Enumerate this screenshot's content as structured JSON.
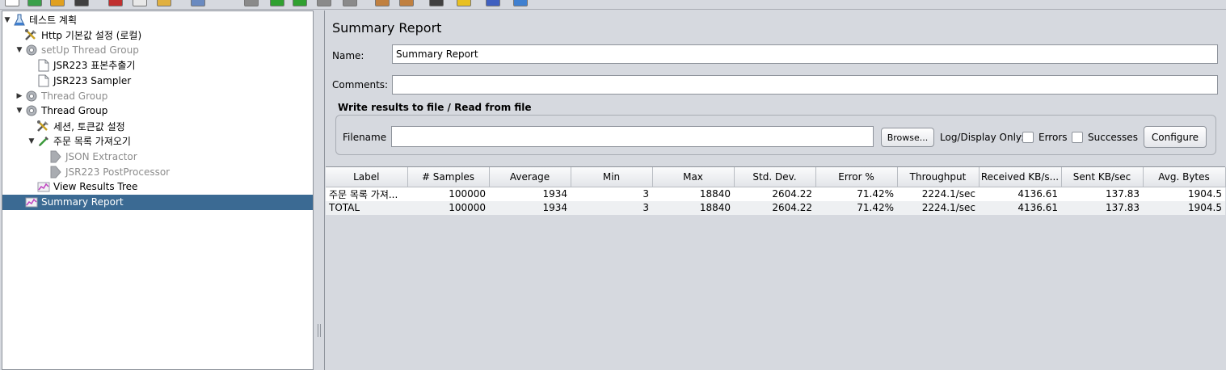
{
  "toolbar": {
    "icons": [
      "new-icon",
      "templates-icon",
      "open-icon",
      "save-icon",
      "cut-icon",
      "copy-icon",
      "paste-icon",
      "expand-icon",
      "toggle-icon",
      "start-icon",
      "start-no-pause-icon",
      "stop-icon",
      "shutdown-icon",
      "clear-icon",
      "clear-all-icon",
      "search-icon",
      "reset-search-icon",
      "function-helper-icon",
      "help-icon"
    ]
  },
  "tree": [
    {
      "label": "테스트 계획",
      "indent": 0,
      "toggle": "▼",
      "icon": "test-plan-icon",
      "disabled": false
    },
    {
      "label": "Http 기본값 설정 (로컬)",
      "indent": 1,
      "toggle": "",
      "icon": "config-element-icon",
      "disabled": false
    },
    {
      "label": "setUp Thread Group",
      "indent": 1,
      "toggle": "▼",
      "icon": "thread-group-icon",
      "disabled": true
    },
    {
      "label": "JSR223 표본추출기",
      "indent": 2,
      "toggle": "",
      "icon": "sampler-icon",
      "disabled": false
    },
    {
      "label": "JSR223 Sampler",
      "indent": 2,
      "toggle": "",
      "icon": "sampler-icon",
      "disabled": false
    },
    {
      "label": "Thread Group",
      "indent": 1,
      "toggle": "▶",
      "icon": "thread-group-icon",
      "disabled": true
    },
    {
      "label": "Thread Group",
      "indent": 1,
      "toggle": "▼",
      "icon": "thread-group-icon",
      "disabled": false
    },
    {
      "label": "세션, 토큰값 설정",
      "indent": 2,
      "toggle": "",
      "icon": "config-element-icon",
      "disabled": false
    },
    {
      "label": "주문 목록 가져오기",
      "indent": 2,
      "toggle": "▼",
      "icon": "http-sampler-icon",
      "disabled": false
    },
    {
      "label": "JSON Extractor",
      "indent": 3,
      "toggle": "",
      "icon": "post-processor-icon",
      "disabled": true
    },
    {
      "label": "JSR223 PostProcessor",
      "indent": 3,
      "toggle": "",
      "icon": "post-processor-icon",
      "disabled": true
    },
    {
      "label": "View Results Tree",
      "indent": 2,
      "toggle": "",
      "icon": "listener-icon",
      "disabled": false
    },
    {
      "label": "Summary Report",
      "indent": 1,
      "toggle": "",
      "icon": "listener-icon",
      "disabled": false,
      "selected": true
    }
  ],
  "panel": {
    "title": "Summary Report",
    "name_label": "Name:",
    "name_value": "Summary Report",
    "comments_label": "Comments:",
    "comments_value": "",
    "file_group_title": "Write results to file / Read from file",
    "filename_label": "Filename",
    "filename_value": "",
    "browse_label": "Browse...",
    "log_display_label": "Log/Display Only:",
    "errors_label": "Errors",
    "successes_label": "Successes",
    "configure_label": "Configure"
  },
  "table": {
    "columns": [
      "Label",
      "# Samples",
      "Average",
      "Min",
      "Max",
      "Std. Dev.",
      "Error %",
      "Throughput",
      "Received KB/s...",
      "Sent KB/sec",
      "Avg. Bytes"
    ],
    "rows": [
      [
        "주문 목록 가져...",
        "100000",
        "1934",
        "3",
        "18840",
        "2604.22",
        "71.42%",
        "2224.1/sec",
        "4136.61",
        "137.83",
        "1904.5"
      ],
      [
        "TOTAL",
        "100000",
        "1934",
        "3",
        "18840",
        "2604.22",
        "71.42%",
        "2224.1/sec",
        "4136.61",
        "137.83",
        "1904.5"
      ]
    ]
  },
  "colors": {
    "selection": "#3b6a93",
    "panel_bg": "#d6d9df",
    "disabled_text": "#8c8c8c"
  }
}
